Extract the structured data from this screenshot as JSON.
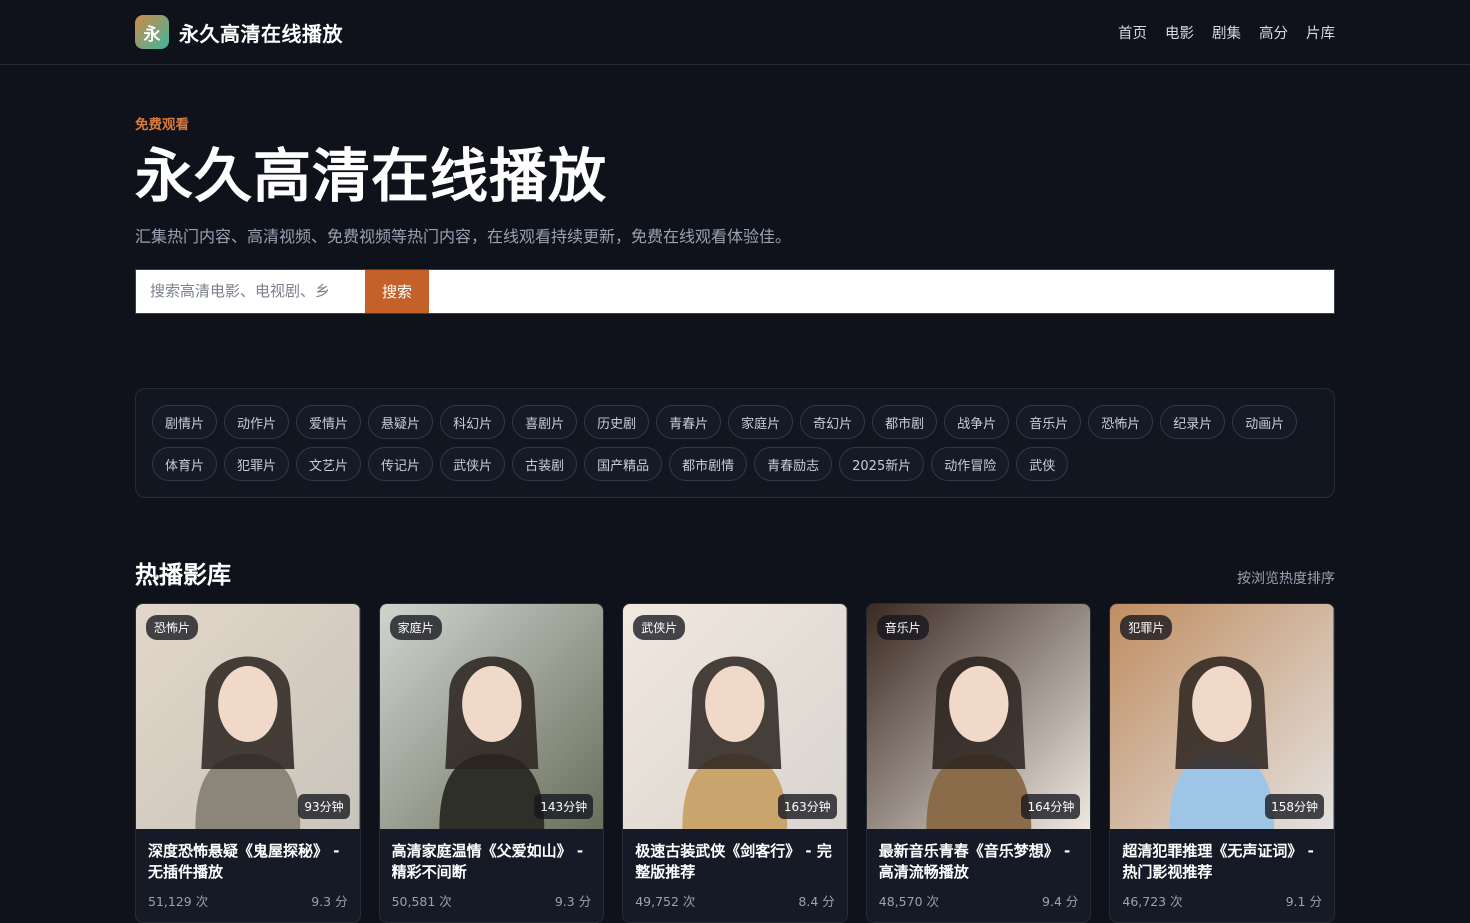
{
  "header": {
    "logo_char": "永",
    "brand": "永久高清在线播放",
    "nav": [
      "首页",
      "电影",
      "剧集",
      "高分",
      "片库"
    ]
  },
  "hero": {
    "eyebrow": "免费观看",
    "title": "永久高清在线播放",
    "subtitle": "汇集热门内容、高清视频、免费视频等热门内容，在线观看持续更新，免费在线观看体验佳。",
    "search_placeholder": "搜索高清电影、电视剧、乡",
    "search_button": "搜索"
  },
  "tags": [
    "剧情片",
    "动作片",
    "爱情片",
    "悬疑片",
    "科幻片",
    "喜剧片",
    "历史剧",
    "青春片",
    "家庭片",
    "奇幻片",
    "都市剧",
    "战争片",
    "音乐片",
    "恐怖片",
    "纪录片",
    "动画片",
    "体育片",
    "犯罪片",
    "文艺片",
    "传记片",
    "武侠片",
    "古装剧",
    "国产精品",
    "都市剧情",
    "青春励志",
    "2025新片",
    "动作冒险",
    "武侠"
  ],
  "section": {
    "title": "热播影库",
    "sort": "按浏览热度排序"
  },
  "cards": [
    {
      "badge": "恐怖片",
      "duration": "93分钟",
      "title": "深度恐怖悬疑《鬼屋探秘》 - 无插件播放",
      "views": "51,129 次",
      "score": "9.3 分",
      "palette": [
        "#c9c4bb",
        "#8c8579",
        "#e2d6c8"
      ]
    },
    {
      "badge": "家庭片",
      "duration": "143分钟",
      "title": "高清家庭温情《父爱如山》 - 精彩不间断",
      "views": "50,581 次",
      "score": "9.3 分",
      "palette": [
        "#6a6e5c",
        "#2e2f29",
        "#cfd4cf"
      ]
    },
    {
      "badge": "武侠片",
      "duration": "163分钟",
      "title": "极速古装武侠《剑客行》 - 完整版推荐",
      "views": "49,752 次",
      "score": "8.4 分",
      "palette": [
        "#d8d4cf",
        "#c9a46c",
        "#f1e8de"
      ]
    },
    {
      "badge": "音乐片",
      "duration": "164分钟",
      "title": "最新音乐青春《音乐梦想》 - 高清流畅播放",
      "views": "48,570 次",
      "score": "9.4 分",
      "palette": [
        "#efe9e2",
        "#8a6b4a",
        "#3a2a22"
      ]
    },
    {
      "badge": "犯罪片",
      "duration": "158分钟",
      "title": "超清犯罪推理《无声证词》 - 热门影视推荐",
      "views": "46,723 次",
      "score": "9.1 分",
      "palette": [
        "#e4e1df",
        "#9ec4e6",
        "#c08e62"
      ]
    }
  ]
}
